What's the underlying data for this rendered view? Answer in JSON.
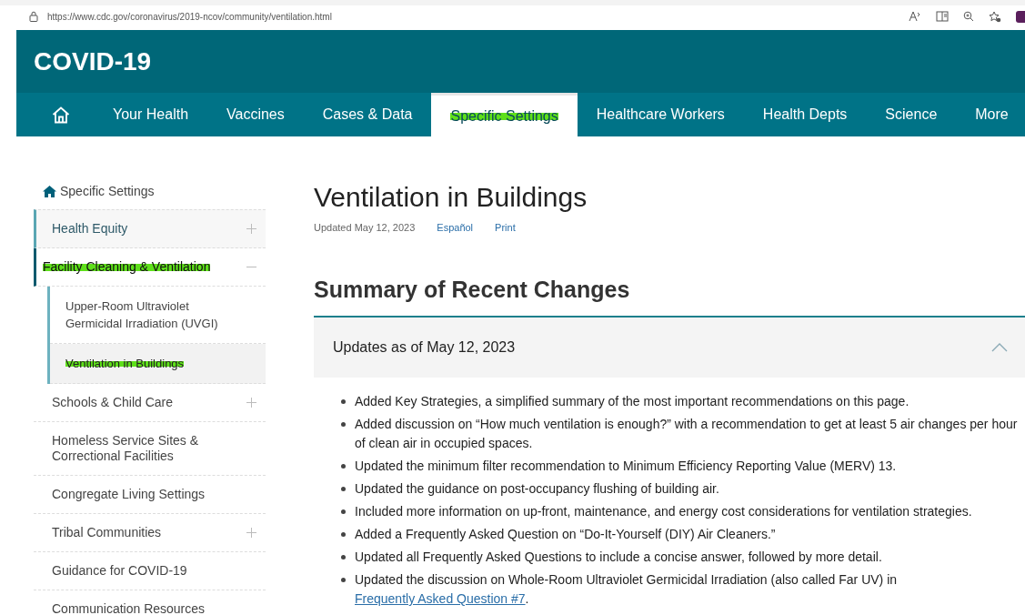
{
  "browser": {
    "url": "https://www.cdc.gov/coronavirus/2019-ncov/community/ventilation.html"
  },
  "site_title": "COVID-19",
  "nav": [
    {
      "kind": "home",
      "selected": false
    },
    {
      "label": "Your Health",
      "selected": false,
      "highlighted": false
    },
    {
      "label": "Vaccines",
      "selected": false,
      "highlighted": false
    },
    {
      "label": "Cases & Data",
      "selected": false,
      "highlighted": false
    },
    {
      "label": "Specific Settings",
      "selected": true,
      "highlighted": true
    },
    {
      "label": "Healthcare Workers",
      "selected": false,
      "highlighted": false
    },
    {
      "label": "Health Depts",
      "selected": false,
      "highlighted": false
    },
    {
      "label": "Science",
      "selected": false,
      "highlighted": false
    },
    {
      "label": "More",
      "selected": false,
      "highlighted": false
    }
  ],
  "sidebar": {
    "home": "Specific Settings",
    "items": [
      {
        "label": "Health Equity",
        "expandable": true,
        "expanded": false,
        "selected": false,
        "highlighted": false
      },
      {
        "label": "Facility Cleaning & Ventilation",
        "expandable": true,
        "expanded": true,
        "selected": false,
        "highlighted": true,
        "children": [
          {
            "label": "Upper-Room Ultraviolet Germicidal Irradiation (UVGI)",
            "selected": false,
            "highlighted": false
          },
          {
            "label": "Ventilation in Buildings",
            "selected": true,
            "highlighted": true
          }
        ]
      },
      {
        "label": "Schools & Child Care",
        "expandable": true,
        "expanded": false,
        "selected": false,
        "highlighted": false
      },
      {
        "label": "Homeless Service Sites & Correctional Facilities",
        "expandable": false,
        "selected": false,
        "highlighted": false
      },
      {
        "label": "Congregate Living Settings",
        "expandable": false,
        "selected": false,
        "highlighted": false
      },
      {
        "label": "Tribal Communities",
        "expandable": true,
        "expanded": false,
        "selected": false,
        "highlighted": false
      },
      {
        "label": "Guidance for COVID-19",
        "expandable": false,
        "selected": false,
        "highlighted": false
      },
      {
        "label": "Communication Resources",
        "expandable": false,
        "selected": false,
        "highlighted": false
      }
    ]
  },
  "page": {
    "title": "Ventilation in Buildings",
    "updated": "Updated May 12, 2023",
    "links": [
      "Español",
      "Print"
    ],
    "section_title": "Summary of Recent Changes",
    "accordion": {
      "title": "Updates as of May 12, 2023",
      "expanded": true,
      "items": [
        {
          "text": "Added Key Strategies, a simplified summary of the most important recommendations on this page."
        },
        {
          "text": "Added discussion on “How much ventilation is enough?” with a recommendation to get at least 5 air changes per hour of clean air in occupied spaces."
        },
        {
          "text": "Updated the minimum filter recommendation to Minimum Efficiency Reporting Value (MERV) 13."
        },
        {
          "text": "Updated the guidance on post-occupancy flushing of building air."
        },
        {
          "text": "Included more information on up-front, maintenance, and energy cost considerations for ventilation strategies."
        },
        {
          "text": "Added a Frequently Asked Question on “Do-It-Yourself (DIY) Air Cleaners.”"
        },
        {
          "text": "Updated all Frequently Asked Questions to include a concise answer, followed by more detail."
        },
        {
          "text": "Updated the discussion on Whole-Room Ultraviolet Germicidal Irradiation (also called Far UV) in ",
          "link": "Frequently Asked Question #7",
          "after": "."
        }
      ]
    }
  }
}
